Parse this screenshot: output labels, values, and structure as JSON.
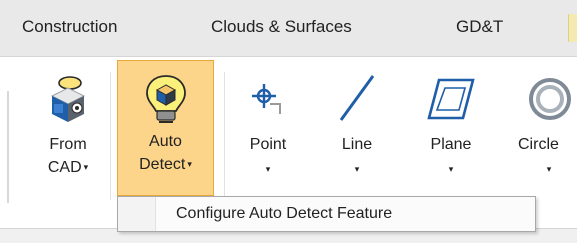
{
  "tabs": [
    {
      "label": "Construction"
    },
    {
      "label": "Clouds & Surfaces"
    },
    {
      "label": "GD&T"
    }
  ],
  "ribbon": {
    "buttons": [
      {
        "line1": "From",
        "line2": "CAD",
        "has_caret": true,
        "icon": "cad-cube-icon"
      },
      {
        "line1": "Auto",
        "line2": "Detect",
        "has_caret": true,
        "icon": "lightbulb-cube-icon",
        "active": true
      },
      {
        "line1": "Point",
        "line2": "",
        "has_caret": true,
        "icon": "point-crosshair-icon"
      },
      {
        "line1": "Line",
        "line2": "",
        "has_caret": true,
        "icon": "line-icon"
      },
      {
        "line1": "Plane",
        "line2": "",
        "has_caret": true,
        "icon": "plane-icon"
      },
      {
        "line1": "Circle",
        "line2": "",
        "has_caret": true,
        "icon": "circle-icon"
      }
    ],
    "caret": "▾"
  },
  "dropdown": {
    "items": [
      {
        "label": "Configure Auto Detect Feature"
      }
    ]
  },
  "colors": {
    "active_fill": "#fdd58a",
    "active_border": "#e9a93a",
    "icon_blue": "#1f5ea8",
    "tab_bar": "#e9e9e9"
  }
}
